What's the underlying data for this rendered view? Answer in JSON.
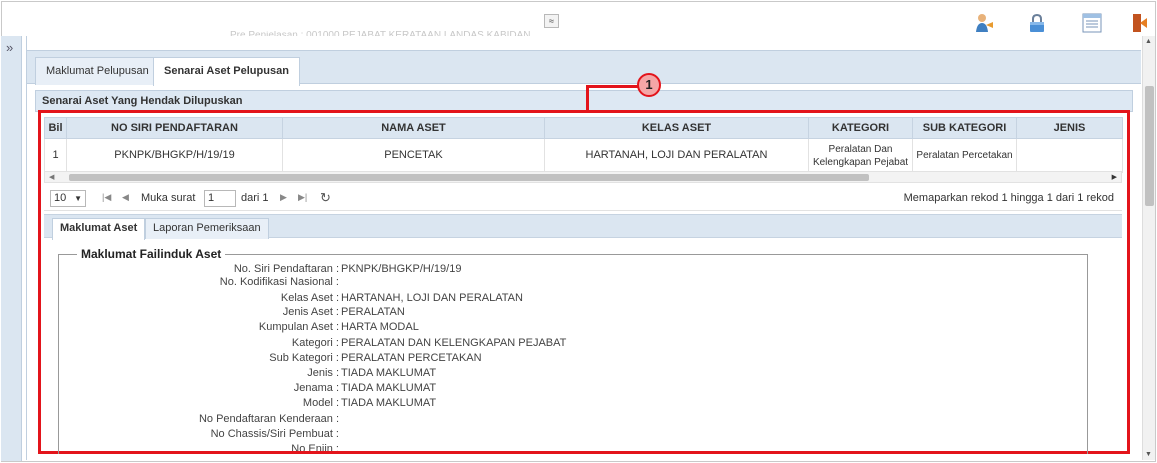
{
  "header": {
    "collapse_glyph": "≈",
    "faded_text": "Pre Penjelasan : 001000 PEJABAT KERATAAN LANDAS KABIDAN",
    "icons": [
      "user-icon",
      "lock-icon",
      "list-icon",
      "exit-icon"
    ]
  },
  "sidebar": {
    "expand_glyph": "»"
  },
  "tabs": [
    {
      "label": "Maklumat Pelupusan",
      "active": false
    },
    {
      "label": "Senarai Aset Pelupusan",
      "active": true
    }
  ],
  "section_title": "Senarai Aset Yang Hendak Dilupuskan",
  "callout": "1",
  "grid": {
    "columns": [
      "Bil",
      "NO SIRI PENDAFTARAN",
      "NAMA ASET",
      "KELAS ASET",
      "KATEGORI",
      "SUB KATEGORI",
      "JENIS"
    ],
    "rows": [
      [
        "1",
        "PKNPK/BHGKP/H/19/19",
        "PENCETAK",
        "HARTANAH, LOJI DAN PERALATAN",
        "Peralatan Dan Kelengkapan Pejabat",
        "Peralatan Percetakan",
        ""
      ]
    ]
  },
  "pager": {
    "page_size": "10",
    "page_label": "Muka surat",
    "page_value": "1",
    "of_label": "dari 1",
    "info": "Memaparkan rekod 1 hingga 1 dari 1 rekod"
  },
  "inner_tabs": [
    {
      "label": "Maklumat Aset",
      "active": true
    },
    {
      "label": "Laporan Pemeriksaan",
      "active": false
    }
  ],
  "details": {
    "legend": "Maklumat Failinduk Aset",
    "fields": [
      {
        "label": "No. Siri Pendaftaran :",
        "value": "PKNPK/BHGKP/H/19/19"
      },
      {
        "label": "No. Kodifikasi Nasional :",
        "value": ""
      },
      {
        "label": "Kelas Aset :",
        "value": "HARTANAH, LOJI DAN PERALATAN"
      },
      {
        "label": "Jenis Aset :",
        "value": "PERALATAN"
      },
      {
        "label": "Kumpulan Aset :",
        "value": "HARTA MODAL"
      },
      {
        "label": "Kategori :",
        "value": "PERALATAN DAN KELENGKAPAN PEJABAT"
      },
      {
        "label": "Sub Kategori :",
        "value": "PERALATAN PERCETAKAN"
      },
      {
        "label": "Jenis :",
        "value": "TIADA MAKLUMAT"
      },
      {
        "label": "Jenama :",
        "value": "TIADA MAKLUMAT"
      },
      {
        "label": "Model :",
        "value": "TIADA MAKLUMAT"
      },
      {
        "label": "No Pendaftaran Kenderaan :",
        "value": ""
      },
      {
        "label": "No Chassis/Siri Pembuat :",
        "value": ""
      },
      {
        "label": "No Enjin :",
        "value": ""
      }
    ]
  },
  "colors": {
    "highlight": "#e3141b",
    "header_bg": "#dbe6f1"
  }
}
